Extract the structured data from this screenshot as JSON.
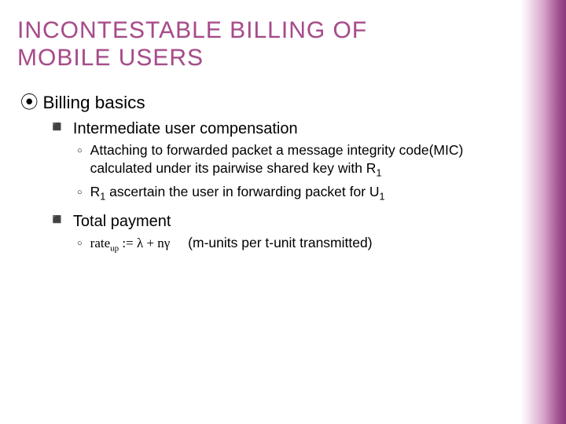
{
  "title_line1": "INCONTESTABLE BILLING OF",
  "title_line2": "MOBILE USERS",
  "level1": {
    "bullet": "⦿",
    "text": "Billing basics"
  },
  "level2a": {
    "bullet": "◾",
    "text": "Intermediate user compensation"
  },
  "level3a": {
    "bullet": "○",
    "text_pre": "Attaching to forwarded packet a message integrity code(MIC) calculated under its pairwise shared key with R",
    "text_sub": "1"
  },
  "level3b": {
    "bullet": "○",
    "text_r": "R",
    "text_r_sub": "1",
    "text_mid": " ascertain the user in forwarding packet for U",
    "text_u_sub": "1"
  },
  "level2b": {
    "bullet": "◾",
    "text": "Total payment"
  },
  "level3c": {
    "bullet": "○",
    "formula_lhs": "rate",
    "formula_lhs_sub": "up",
    "formula_assign": " := ",
    "formula_rhs": "λ + nγ",
    "text": "(m-units per t-unit transmitted)"
  }
}
